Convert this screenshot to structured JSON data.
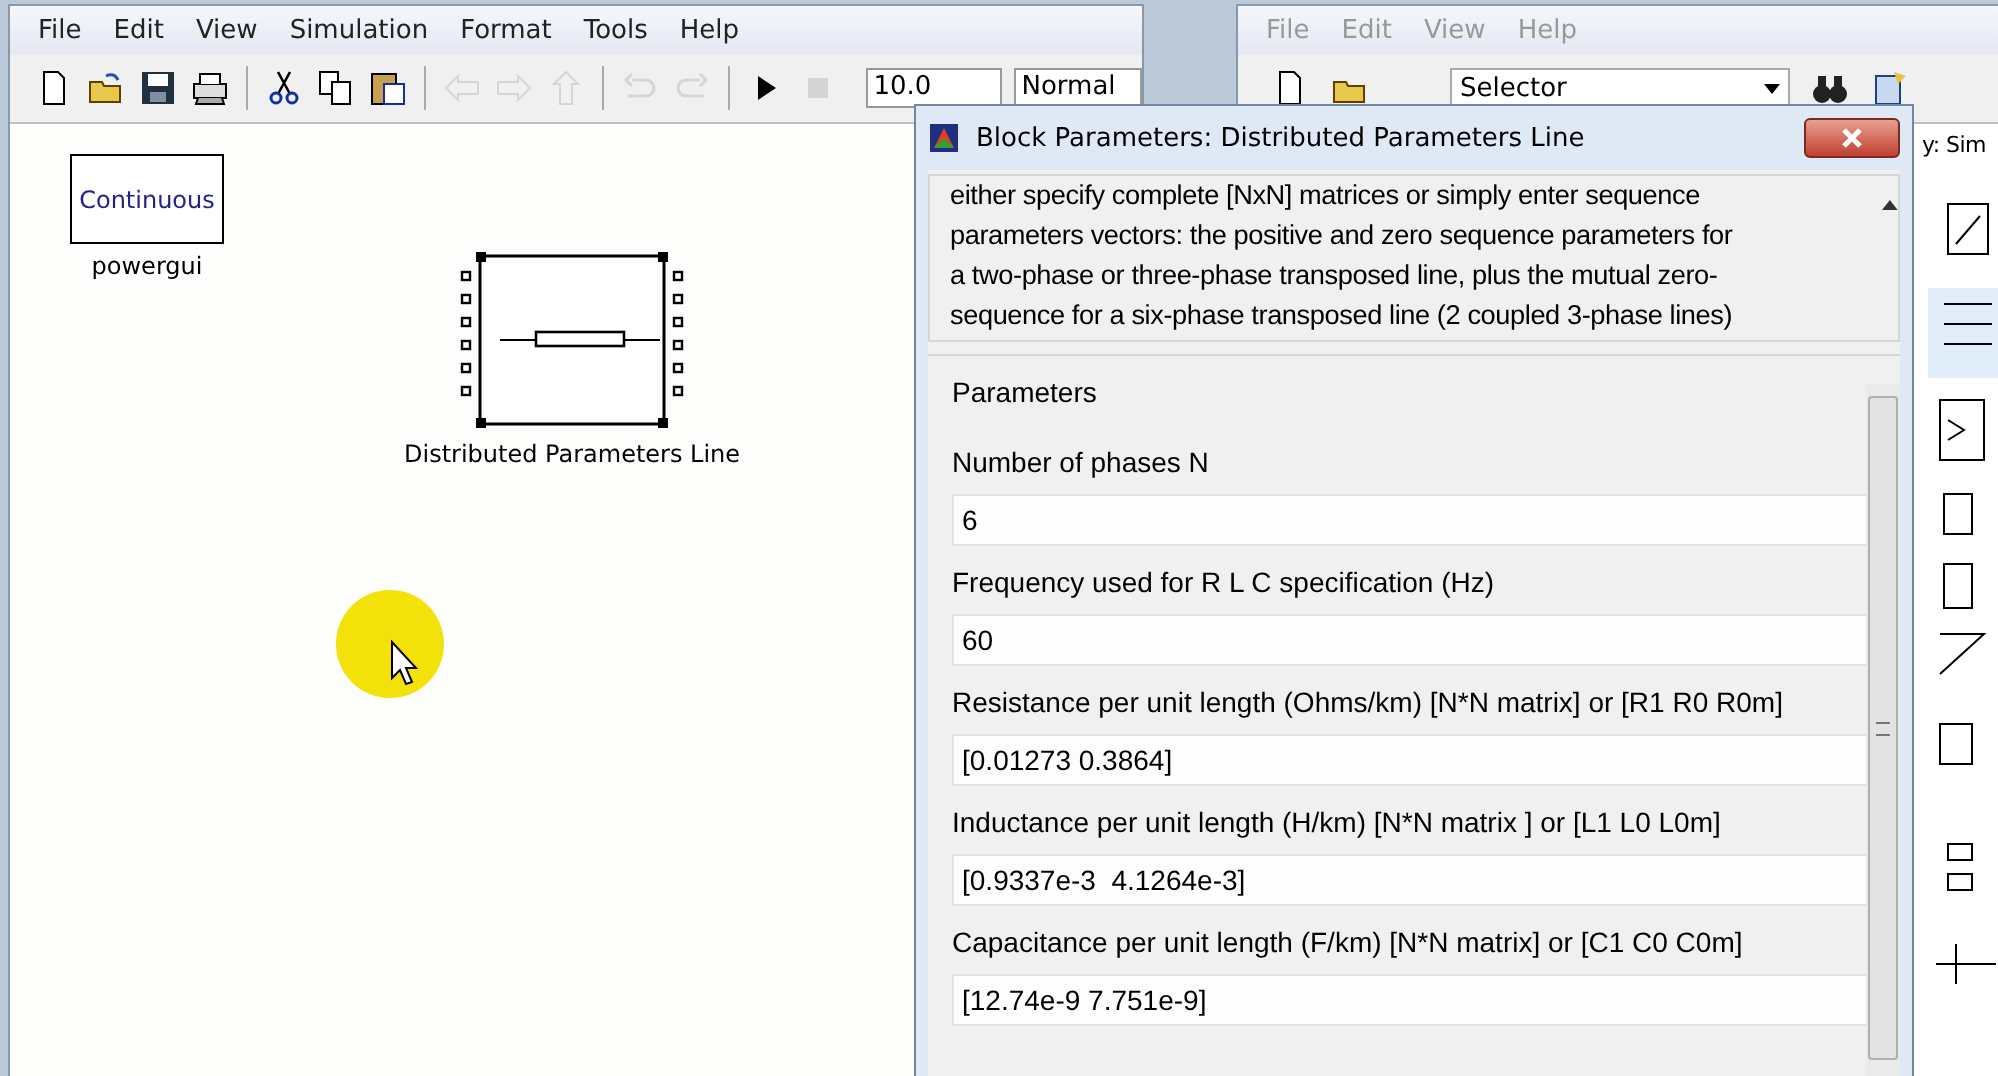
{
  "model_window": {
    "menu": [
      "File",
      "Edit",
      "View",
      "Simulation",
      "Format",
      "Tools",
      "Help"
    ],
    "toolbar": [
      {
        "kind": "new",
        "disabled": false
      },
      {
        "kind": "open",
        "disabled": false
      },
      {
        "kind": "save",
        "disabled": false
      },
      {
        "kind": "print",
        "disabled": false
      },
      {
        "kind": "sep"
      },
      {
        "kind": "cut",
        "disabled": false
      },
      {
        "kind": "copy",
        "disabled": false
      },
      {
        "kind": "paste",
        "disabled": false
      },
      {
        "kind": "sep"
      },
      {
        "kind": "back",
        "disabled": true
      },
      {
        "kind": "forward",
        "disabled": true
      },
      {
        "kind": "up",
        "disabled": true
      },
      {
        "kind": "sep"
      },
      {
        "kind": "undo",
        "disabled": true
      },
      {
        "kind": "redo",
        "disabled": true
      },
      {
        "kind": "sep"
      },
      {
        "kind": "play",
        "disabled": false
      },
      {
        "kind": "stop",
        "disabled": true
      }
    ],
    "stop_time": "10.0",
    "sim_mode": "Normal",
    "blocks": [
      {
        "kind": "powergui",
        "text": "Continuous",
        "label": "powergui",
        "selected": false
      },
      {
        "kind": "line",
        "label": "Distributed Parameters Line",
        "selected": true
      }
    ]
  },
  "library_window": {
    "menu": [
      "File",
      "Edit",
      "View",
      "Help"
    ],
    "selector": "Selector",
    "header": "y: Sim"
  },
  "dialog": {
    "title": "Block Parameters: Distributed Parameters Line",
    "description": "either specify complete [NxN] matrices or simply enter sequence\nparameters vectors: the  positive and zero sequence parameters for\na two-phase or  three-phase transposed  line, plus the mutual zero-\nsequence for a  six-phase transposed  line  (2 coupled 3-phase lines)",
    "section": "Parameters",
    "params": [
      {
        "label": "Number of phases N",
        "value": "6"
      },
      {
        "label": "Frequency used for R L C specification (Hz)",
        "value": "60"
      },
      {
        "label": "Resistance per unit length (Ohms/km)   [N*N matrix] or [R1 R0 R0m]",
        "value": "[0.01273 0.3864]"
      },
      {
        "label": "Inductance per unit length (H/km) [N*N matrix ] or [L1 L0 L0m]",
        "value": "[0.9337e-3  4.1264e-3]"
      },
      {
        "label": "Capacitance per unit length (F/km) [N*N matrix] or [C1 C0 C0m]",
        "value": "[12.74e-9 7.751e-9]"
      }
    ]
  }
}
